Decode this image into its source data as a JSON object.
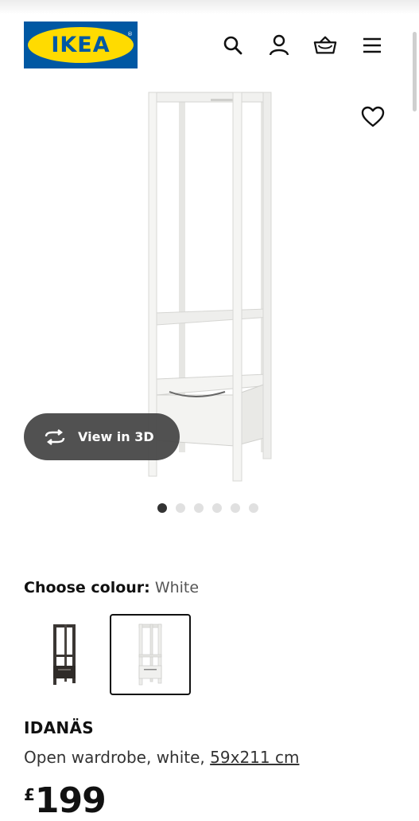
{
  "header": {
    "logo_text": "IKEA",
    "logo_trademark": "®",
    "icons": [
      "search-icon",
      "user-icon",
      "basket-icon",
      "menu-icon"
    ]
  },
  "gallery": {
    "view_3d_label": "View in 3D",
    "dots_count": 6,
    "active_dot": 0
  },
  "colour": {
    "label": "Choose colour:",
    "value": "White",
    "swatches": [
      {
        "name": "dark-brown",
        "color": "#3a3633",
        "selected": false
      },
      {
        "name": "white",
        "color": "#ececea",
        "selected": true
      }
    ]
  },
  "product": {
    "name": "IDANÄS",
    "description": "Open wardrobe, white,",
    "size_link": "59x211 cm",
    "currency": "£",
    "price": "199"
  },
  "colors": {
    "ikea_blue": "#0058a3",
    "ikea_yellow": "#ffdb00",
    "pill_bg": "#484848"
  }
}
